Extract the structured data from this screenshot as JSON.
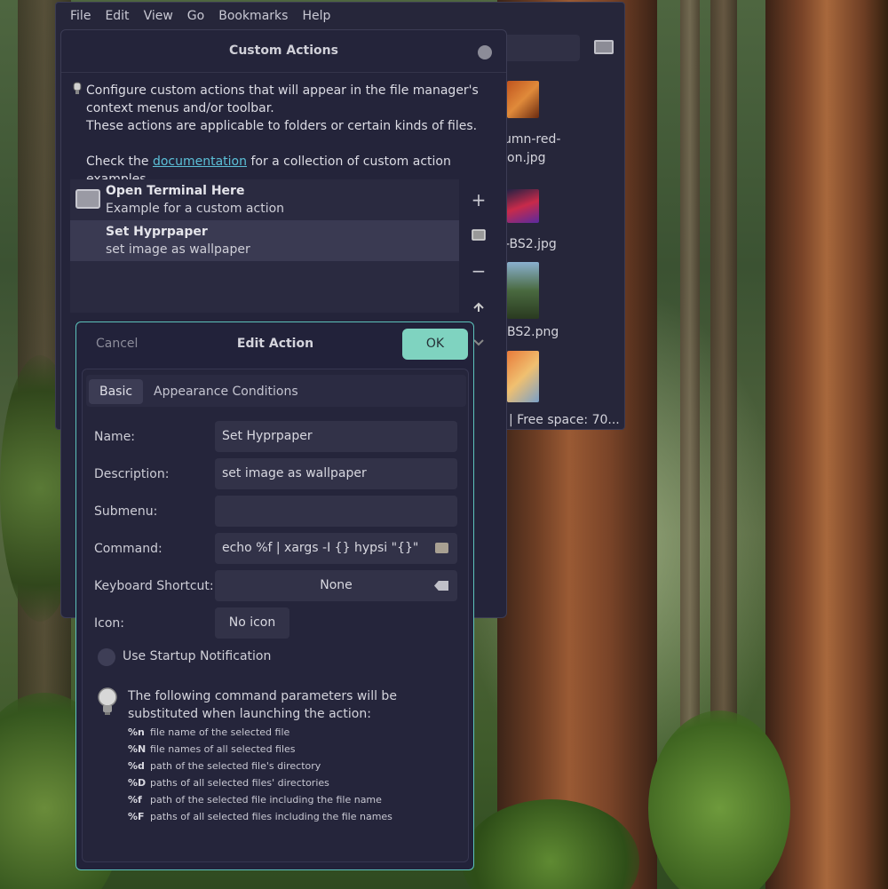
{
  "file_manager": {
    "menu": [
      "File",
      "Edit",
      "View",
      "Go",
      "Bookmarks",
      "Help"
    ],
    "files": [
      "umn-red-",
      "on.jpg",
      "-BS2.jpg",
      "BS2.png"
    ],
    "status": "|  Free space: 70..."
  },
  "custom_actions": {
    "title": "Custom Actions",
    "description_line1": "Configure custom actions that will appear in the file manager's context menus and/or toolbar.",
    "description_line2": "These actions are applicable to folders or certain kinds of files.",
    "description_pre": "Check the ",
    "link": "documentation",
    "description_post": " for a collection of custom action examples.",
    "actions": [
      {
        "title": "Open Terminal Here",
        "subtitle": "Example for a custom action"
      },
      {
        "title": "Set Hyprpaper",
        "subtitle": "set image as wallpaper"
      }
    ],
    "side_buttons": {
      "add": "+",
      "remove": "−"
    }
  },
  "edit_action": {
    "cancel_label": "Cancel",
    "title": "Edit Action",
    "ok_label": "OK",
    "tabs": [
      "Basic",
      "Appearance Conditions"
    ],
    "labels": {
      "name": "Name:",
      "description": "Description:",
      "submenu": "Submenu:",
      "command": "Command:",
      "shortcut": "Keyboard Shortcut:",
      "icon": "Icon:"
    },
    "values": {
      "name": "Set Hyprpaper",
      "description": "set image as wallpaper",
      "submenu": "",
      "command": "echo %f | xargs -I {} hypsi \"{}\"",
      "shortcut": "None",
      "icon": "No icon"
    },
    "startup_notification": "Use Startup Notification",
    "help_text": "The following command parameters will be substituted when launching the action:",
    "params": [
      {
        "code": "%n",
        "desc": "file name of the selected file"
      },
      {
        "code": "%N",
        "desc": "file names of all selected files"
      },
      {
        "code": "%d",
        "desc": "path of the selected file's directory"
      },
      {
        "code": "%D",
        "desc": "paths of all selected files' directories"
      },
      {
        "code": "%f",
        "desc": "path of the selected file including the file name"
      },
      {
        "code": "%F",
        "desc": "paths of all selected files including the file names"
      }
    ]
  }
}
